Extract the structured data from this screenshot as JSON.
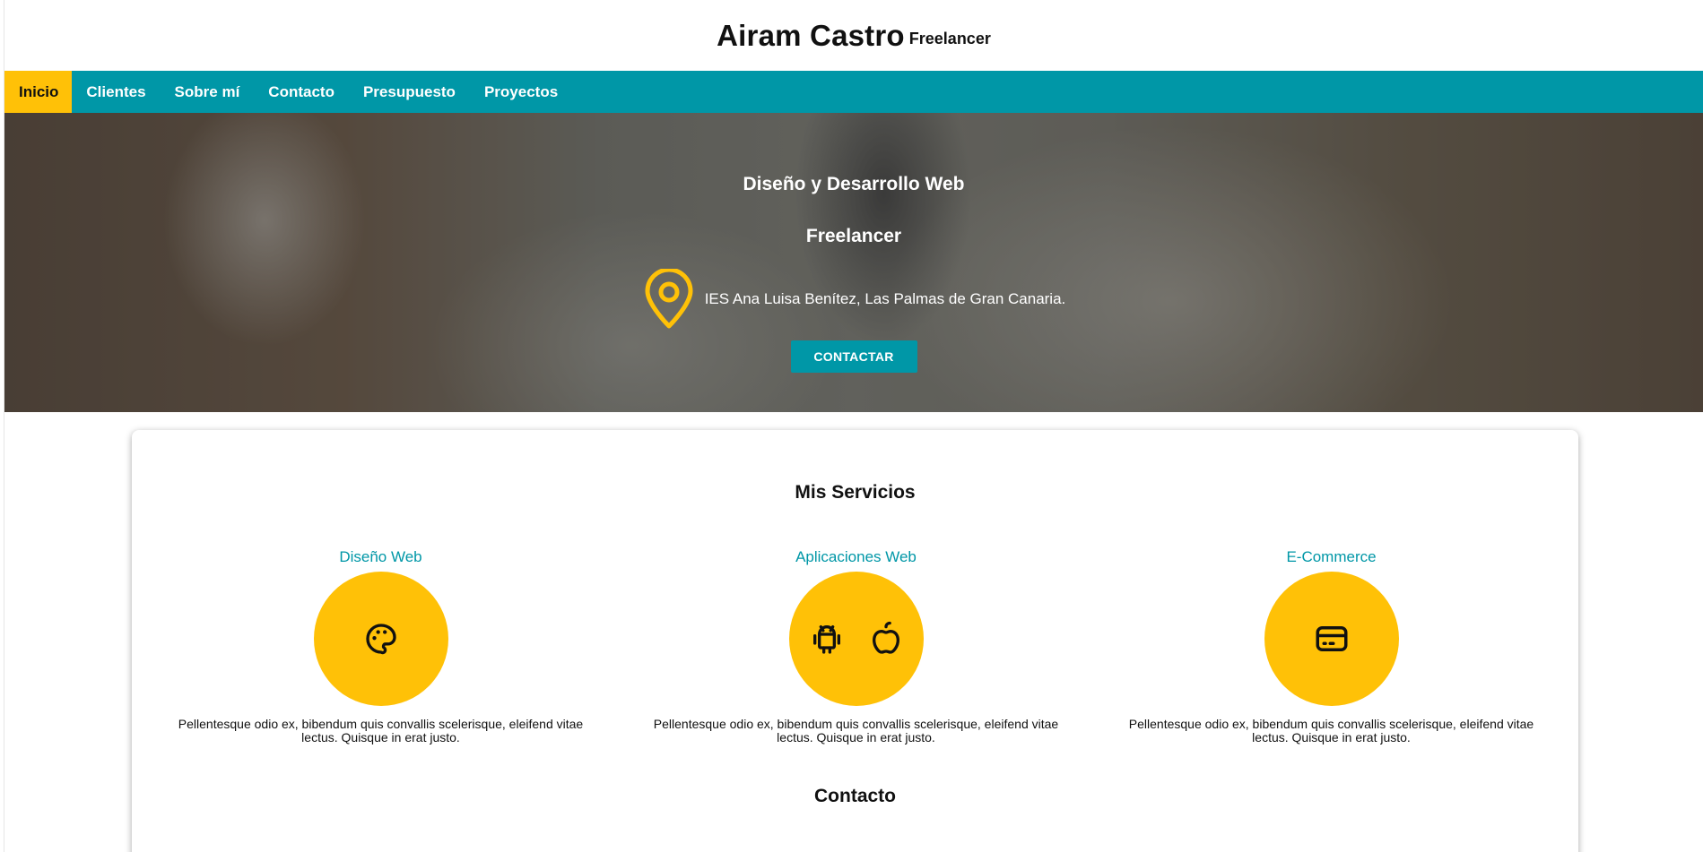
{
  "header": {
    "name": "Airam Castro",
    "role": "Freelancer"
  },
  "nav": {
    "items": [
      {
        "label": "Inicio",
        "active": true
      },
      {
        "label": "Clientes"
      },
      {
        "label": "Sobre mí"
      },
      {
        "label": "Contacto"
      },
      {
        "label": "Presupuesto"
      },
      {
        "label": "Proyectos"
      }
    ]
  },
  "hero": {
    "title": "Diseño y Desarrollo Web",
    "subtitle": "Freelancer",
    "location": "IES Ana Luisa Benítez, Las Palmas de Gran Canaria.",
    "button": "CONTACTAR"
  },
  "services": {
    "title": "Mis Servicios",
    "items": [
      {
        "name": "Diseño Web",
        "icon": "palette-icon",
        "desc": "Pellentesque odio ex, bibendum quis convallis scelerisque, eleifend vitae lectus. Quisque in erat justo."
      },
      {
        "name": "Aplicaciones Web",
        "icon": "android-icon, apple-icon",
        "desc": "Pellentesque odio ex, bibendum quis convallis scelerisque, eleifend vitae lectus. Quisque in erat justo."
      },
      {
        "name": "E-Commerce",
        "icon": "credit-card-icon",
        "desc": "Pellentesque odio ex, bibendum quis convallis scelerisque, eleifend vitae lectus. Quisque in erat justo."
      }
    ]
  },
  "contact": {
    "title": "Contacto"
  },
  "colors": {
    "primary": "#0097a7",
    "accent": "#ffc107",
    "text": "#111111"
  }
}
